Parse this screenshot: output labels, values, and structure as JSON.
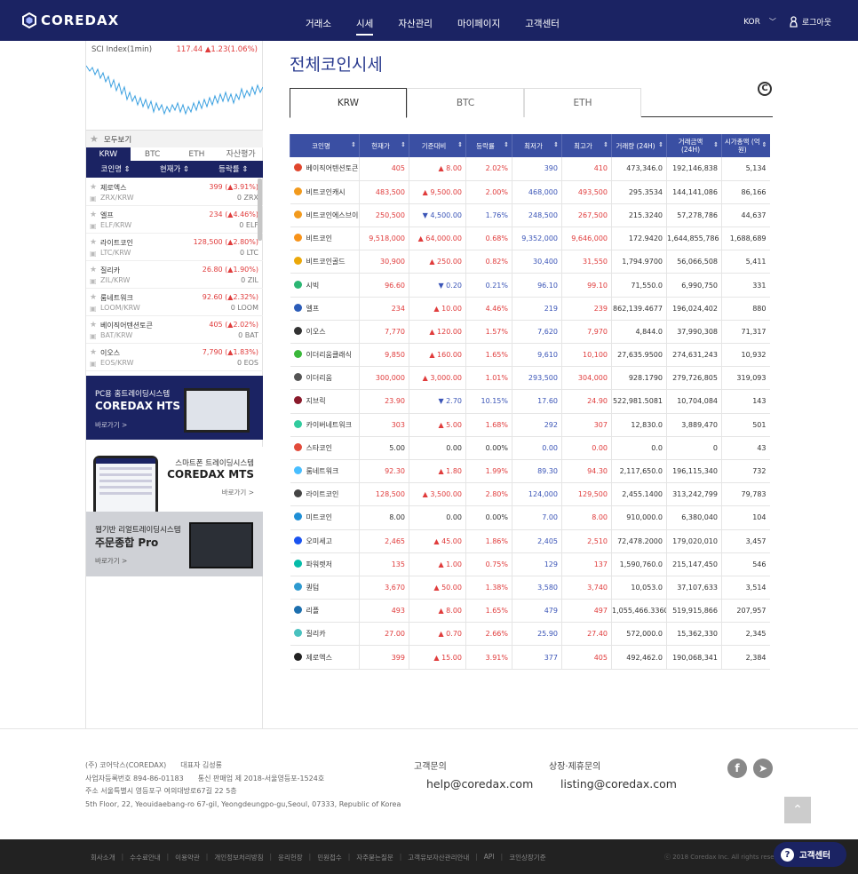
{
  "header": {
    "logo": "COREDAX",
    "nav": [
      "거래소",
      "시세",
      "자산관리",
      "마이페이지",
      "고객센터"
    ],
    "active_nav": 1,
    "lang": "KOR",
    "logout": "로그아웃"
  },
  "sidebar": {
    "sci": {
      "label": "SCI Index(1min)",
      "value": "117.44",
      "change": "▲1.23(1.06%)"
    },
    "fav": "모두보기",
    "tabs": [
      "KRW",
      "BTC",
      "ETH",
      "자산평가"
    ],
    "head": [
      "코인명 ⇕",
      "현재가 ⇕",
      "등락률 ⇕"
    ],
    "items": [
      {
        "name": "제로엑스",
        "market": "ZRX/KRW",
        "price": "399 (▲3.91%)",
        "hold": "0 ZRX"
      },
      {
        "name": "엘프",
        "market": "ELF/KRW",
        "price": "234 (▲4.46%)",
        "hold": "0 ELF"
      },
      {
        "name": "라이트코인",
        "market": "LTC/KRW",
        "price": "128,500 (▲2.80%)",
        "hold": "0 LTC"
      },
      {
        "name": "질리카",
        "market": "ZIL/KRW",
        "price": "26.80 (▲1.90%)",
        "hold": "0 ZIL"
      },
      {
        "name": "룸네트워크",
        "market": "LOOM/KRW",
        "price": "92.60 (▲2.32%)",
        "hold": "0 LOOM"
      },
      {
        "name": "베이직어텐션토큰",
        "market": "BAT/KRW",
        "price": "405 (▲2.02%)",
        "hold": "0 BAT"
      },
      {
        "name": "이오스",
        "market": "EOS/KRW",
        "price": "7,790 (▲1.83%)",
        "hold": "0 EOS"
      }
    ],
    "ad1": {
      "line1": "PC용 홈트레이딩시스템",
      "line2": "COREDAX HTS",
      "more": "바로가기 >"
    },
    "ad2": {
      "line1": "스마트폰 트레이딩시스템",
      "line2": "COREDAX MTS",
      "more": "바로가기 >"
    },
    "ad3": {
      "line1": "웹기반 리얼트레이딩시스템",
      "line2": "주문종합 Pro",
      "more": "바로가기 >"
    }
  },
  "main": {
    "title": "전체코인시세",
    "tabs": [
      "KRW",
      "BTC",
      "ETH"
    ],
    "columns": [
      "코인명",
      "현재가",
      "기준대비",
      "등락률",
      "최저가",
      "최고가",
      "거래량 (24H)",
      "거래금액 (24H)",
      "시가총액 (억원)"
    ],
    "rows": [
      {
        "name": "베이직어텐션토큰",
        "icon": "#e0462d",
        "price": "405",
        "diff": "▲ 8.00",
        "rate": "2.02%",
        "low": "390",
        "high": "410",
        "vol": "473,346.0",
        "amt": "192,146,838",
        "cap": "5,134",
        "d": "up"
      },
      {
        "name": "비트코인캐시",
        "icon": "#f29a1d",
        "price": "483,500",
        "diff": "▲ 9,500.00",
        "rate": "2.00%",
        "low": "468,000",
        "high": "493,500",
        "vol": "295.3534",
        "amt": "144,141,086",
        "cap": "86,166",
        "d": "up"
      },
      {
        "name": "비트코인에스브이",
        "icon": "#f29a1d",
        "price": "250,500",
        "diff": "▼ 4,500.00",
        "rate": "1.76%",
        "low": "248,500",
        "high": "267,500",
        "vol": "215.3240",
        "amt": "57,278,786",
        "cap": "44,637",
        "d": "dn"
      },
      {
        "name": "비트코인",
        "icon": "#f7931a",
        "price": "9,518,000",
        "diff": "▲ 64,000.00",
        "rate": "0.68%",
        "low": "9,352,000",
        "high": "9,646,000",
        "vol": "172.9420",
        "amt": "1,644,855,786",
        "cap": "1,688,689",
        "d": "up"
      },
      {
        "name": "비트코인골드",
        "icon": "#eba809",
        "price": "30,900",
        "diff": "▲ 250.00",
        "rate": "0.82%",
        "low": "30,400",
        "high": "31,550",
        "vol": "1,794.9700",
        "amt": "56,066,508",
        "cap": "5,411",
        "d": "up"
      },
      {
        "name": "시빅",
        "icon": "#2bb673",
        "price": "96.60",
        "diff": "▼ 0.20",
        "rate": "0.21%",
        "low": "96.10",
        "high": "99.10",
        "vol": "71,550.0",
        "amt": "6,990,750",
        "cap": "331",
        "d": "dn"
      },
      {
        "name": "엘프",
        "icon": "#2b5cb8",
        "price": "234",
        "diff": "▲ 10.00",
        "rate": "4.46%",
        "low": "219",
        "high": "239",
        "vol": "862,139.4677",
        "amt": "196,024,402",
        "cap": "880",
        "d": "up"
      },
      {
        "name": "이오스",
        "icon": "#333333",
        "price": "7,770",
        "diff": "▲ 120.00",
        "rate": "1.57%",
        "low": "7,620",
        "high": "7,970",
        "vol": "4,844.0",
        "amt": "37,990,308",
        "cap": "71,317",
        "d": "up"
      },
      {
        "name": "이더리움클래식",
        "icon": "#3ab83a",
        "price": "9,850",
        "diff": "▲ 160.00",
        "rate": "1.65%",
        "low": "9,610",
        "high": "10,100",
        "vol": "27,635.9500",
        "amt": "274,631,243",
        "cap": "10,932",
        "d": "up"
      },
      {
        "name": "이더리움",
        "icon": "#555555",
        "price": "300,000",
        "diff": "▲ 3,000.00",
        "rate": "1.01%",
        "low": "293,500",
        "high": "304,000",
        "vol": "928.1790",
        "amt": "279,726,805",
        "cap": "319,093",
        "d": "up"
      },
      {
        "name": "지브릭",
        "icon": "#8a1a2b",
        "price": "23.90",
        "diff": "▼ 2.70",
        "rate": "10.15%",
        "low": "17.60",
        "high": "24.90",
        "vol": "522,981.5081",
        "amt": "10,704,084",
        "cap": "143",
        "d": "dn"
      },
      {
        "name": "카이버네트워크",
        "icon": "#31cb9e",
        "price": "303",
        "diff": "▲ 5.00",
        "rate": "1.68%",
        "low": "292",
        "high": "307",
        "vol": "12,830.0",
        "amt": "3,889,470",
        "cap": "501",
        "d": "up"
      },
      {
        "name": "스타코인",
        "icon": "#e24b3b",
        "price": "5.00",
        "diff": "0.00",
        "rate": "0.00%",
        "low": "0.00",
        "high": "0.00",
        "vol": "0.0",
        "amt": "0",
        "cap": "43",
        "d": "bk"
      },
      {
        "name": "룸네트워크",
        "icon": "#48beff",
        "price": "92.30",
        "diff": "▲ 1.80",
        "rate": "1.99%",
        "low": "89.30",
        "high": "94.30",
        "vol": "2,117,650.0",
        "amt": "196,115,340",
        "cap": "732",
        "d": "up"
      },
      {
        "name": "라이트코인",
        "icon": "#444444",
        "price": "128,500",
        "diff": "▲ 3,500.00",
        "rate": "2.80%",
        "low": "124,000",
        "high": "129,500",
        "vol": "2,455.1400",
        "amt": "313,242,799",
        "cap": "79,783",
        "d": "up"
      },
      {
        "name": "미트코인",
        "icon": "#1f8fd6",
        "price": "8.00",
        "diff": "0.00",
        "rate": "0.00%",
        "low": "7.00",
        "high": "8.00",
        "vol": "910,000.0",
        "amt": "6,380,040",
        "cap": "104",
        "d": "bk"
      },
      {
        "name": "오미세고",
        "icon": "#1a53f0",
        "price": "2,465",
        "diff": "▲ 45.00",
        "rate": "1.86%",
        "low": "2,405",
        "high": "2,510",
        "vol": "72,478.2000",
        "amt": "179,020,010",
        "cap": "3,457",
        "d": "up"
      },
      {
        "name": "파워렛저",
        "icon": "#05bca9",
        "price": "135",
        "diff": "▲ 1.00",
        "rate": "0.75%",
        "low": "129",
        "high": "137",
        "vol": "1,590,760.0",
        "amt": "215,147,450",
        "cap": "546",
        "d": "up"
      },
      {
        "name": "퀀텀",
        "icon": "#2e9ad0",
        "price": "3,670",
        "diff": "▲ 50.00",
        "rate": "1.38%",
        "low": "3,580",
        "high": "3,740",
        "vol": "10,053.0",
        "amt": "37,107,633",
        "cap": "3,514",
        "d": "up"
      },
      {
        "name": "리플",
        "icon": "#1c6fae",
        "price": "493",
        "diff": "▲ 8.00",
        "rate": "1.65%",
        "low": "479",
        "high": "497",
        "vol": "1,055,466.3360",
        "amt": "519,915,866",
        "cap": "207,957",
        "d": "up"
      },
      {
        "name": "질리카",
        "icon": "#49c1bf",
        "price": "27.00",
        "diff": "▲ 0.70",
        "rate": "2.66%",
        "low": "25.90",
        "high": "27.40",
        "vol": "572,000.0",
        "amt": "15,362,330",
        "cap": "2,345",
        "d": "up"
      },
      {
        "name": "제로엑스",
        "icon": "#222222",
        "price": "399",
        "diff": "▲ 15.00",
        "rate": "3.91%",
        "low": "377",
        "high": "405",
        "vol": "492,462.0",
        "amt": "190,068,341",
        "cap": "2,384",
        "d": "up"
      }
    ]
  },
  "footer": {
    "company": [
      "(주) 코어닥스(COREDAX)　　대표자 김성룡",
      "사업자등록번호 894-86-01183　　통신 판매업 제 2018-서울영등포-1524호",
      "주소 서울특별시 영등포구 여의대방로67길 22 5층",
      "5th Floor, 22, Yeouidaebang-ro 67-gil, Yeongdeungpo-gu,Seoul, 07333, Republic of Korea"
    ],
    "q1": "고객문의",
    "mail1": "help@coredax.com",
    "q2": "상장·제휴문의",
    "mail2": "listing@coredax.com",
    "links": [
      "회사소개",
      "수수료안내",
      "이용약관",
      "개인정보처리방침",
      "윤리헌장",
      "민원접수",
      "자주묻는질문",
      "고객유보자산관리안내",
      "API",
      "코인상장기준"
    ],
    "copy": "ⓒ 2018 Coredax Inc. All rights reserved.",
    "cs": "고객센터"
  }
}
